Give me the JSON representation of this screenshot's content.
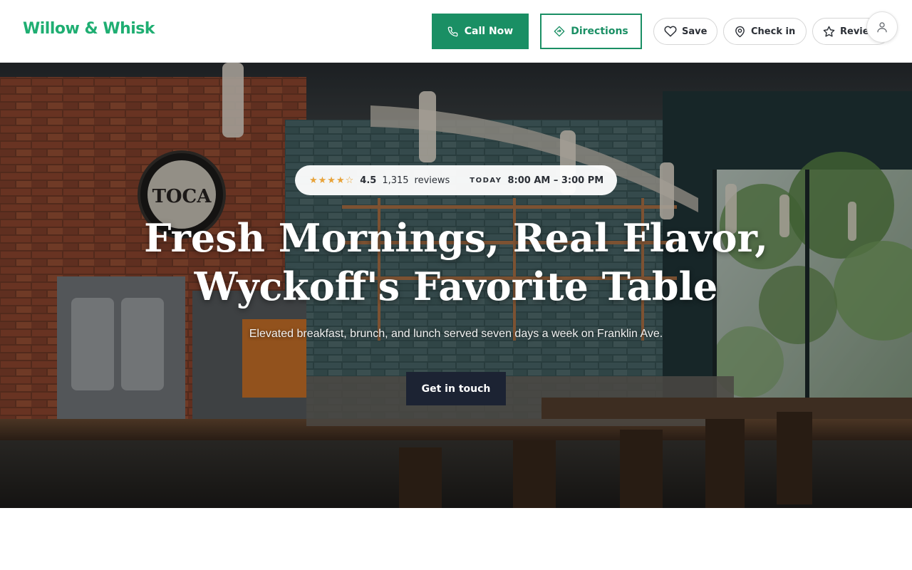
{
  "brand": {
    "name": "Willow & Whisk"
  },
  "header": {
    "call_label": "Call Now",
    "directions_label": "Directions",
    "save_label": "Save",
    "checkin_label": "Check in",
    "review_label": "Review"
  },
  "hero": {
    "stars_text": "★★★★☆",
    "rating": "4.5",
    "review_count": "1,315",
    "reviews_word": "reviews",
    "today_label": "TODAY",
    "hours": "8:00 AM – 3:00 PM",
    "headline_line1": "Fresh Mornings, Real Flavor,",
    "headline_line2": "Wyckoff's Favorite Table",
    "subline": "Elevated breakfast, brunch, and lunch served seven days a week on Franklin Ave.",
    "cta_label": "Get in touch",
    "clock_text": "TOCA"
  },
  "colors": {
    "brand": "#1fae72",
    "primary": "#1a8f64",
    "cta_dark": "#1c2333",
    "star": "#e8a33a"
  },
  "icons": {
    "call": "phone-icon",
    "directions": "directions-icon",
    "save": "heart-icon",
    "checkin": "map-pin-icon",
    "review": "star-icon",
    "account": "user-icon"
  }
}
